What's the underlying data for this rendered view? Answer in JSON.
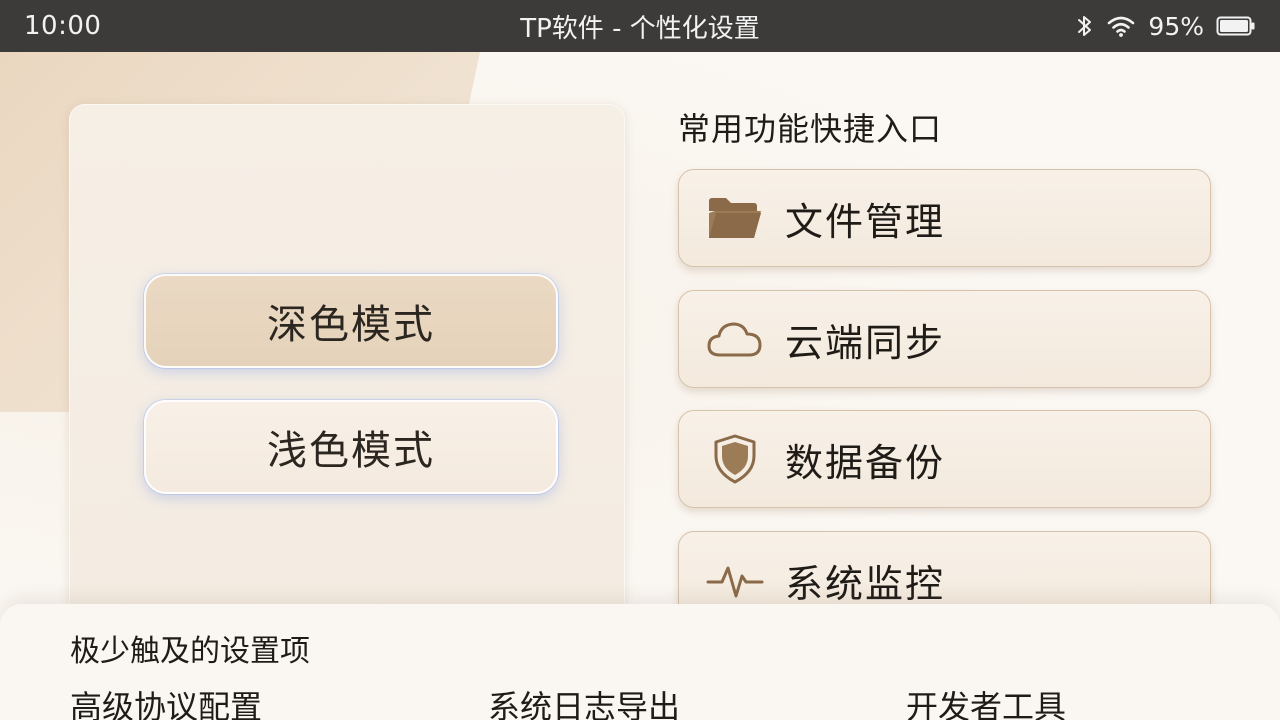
{
  "status_bar": {
    "time": "10:00",
    "title": "TP软件 - 个性化设置",
    "battery": "95%"
  },
  "theme": {
    "dark_mode_label": "深色模式",
    "light_mode_label": "浅色模式"
  },
  "quick_access": {
    "heading": "常用功能快捷入口",
    "items": [
      {
        "label": "文件管理",
        "icon": "folder-icon"
      },
      {
        "label": "云端同步",
        "icon": "cloud-icon"
      },
      {
        "label": "数据备份",
        "icon": "shield-icon"
      },
      {
        "label": "系统监控",
        "icon": "pulse-icon"
      }
    ]
  },
  "rare_settings": {
    "heading": "极少触及的设置项",
    "items": [
      {
        "label": "高级协议配置"
      },
      {
        "label": "系统日志导出"
      },
      {
        "label": "开发者工具"
      }
    ]
  },
  "colors": {
    "status_bar": "#3d3b39",
    "accent_brown": "#8a6a48",
    "card_border": "#d6c3ab"
  }
}
